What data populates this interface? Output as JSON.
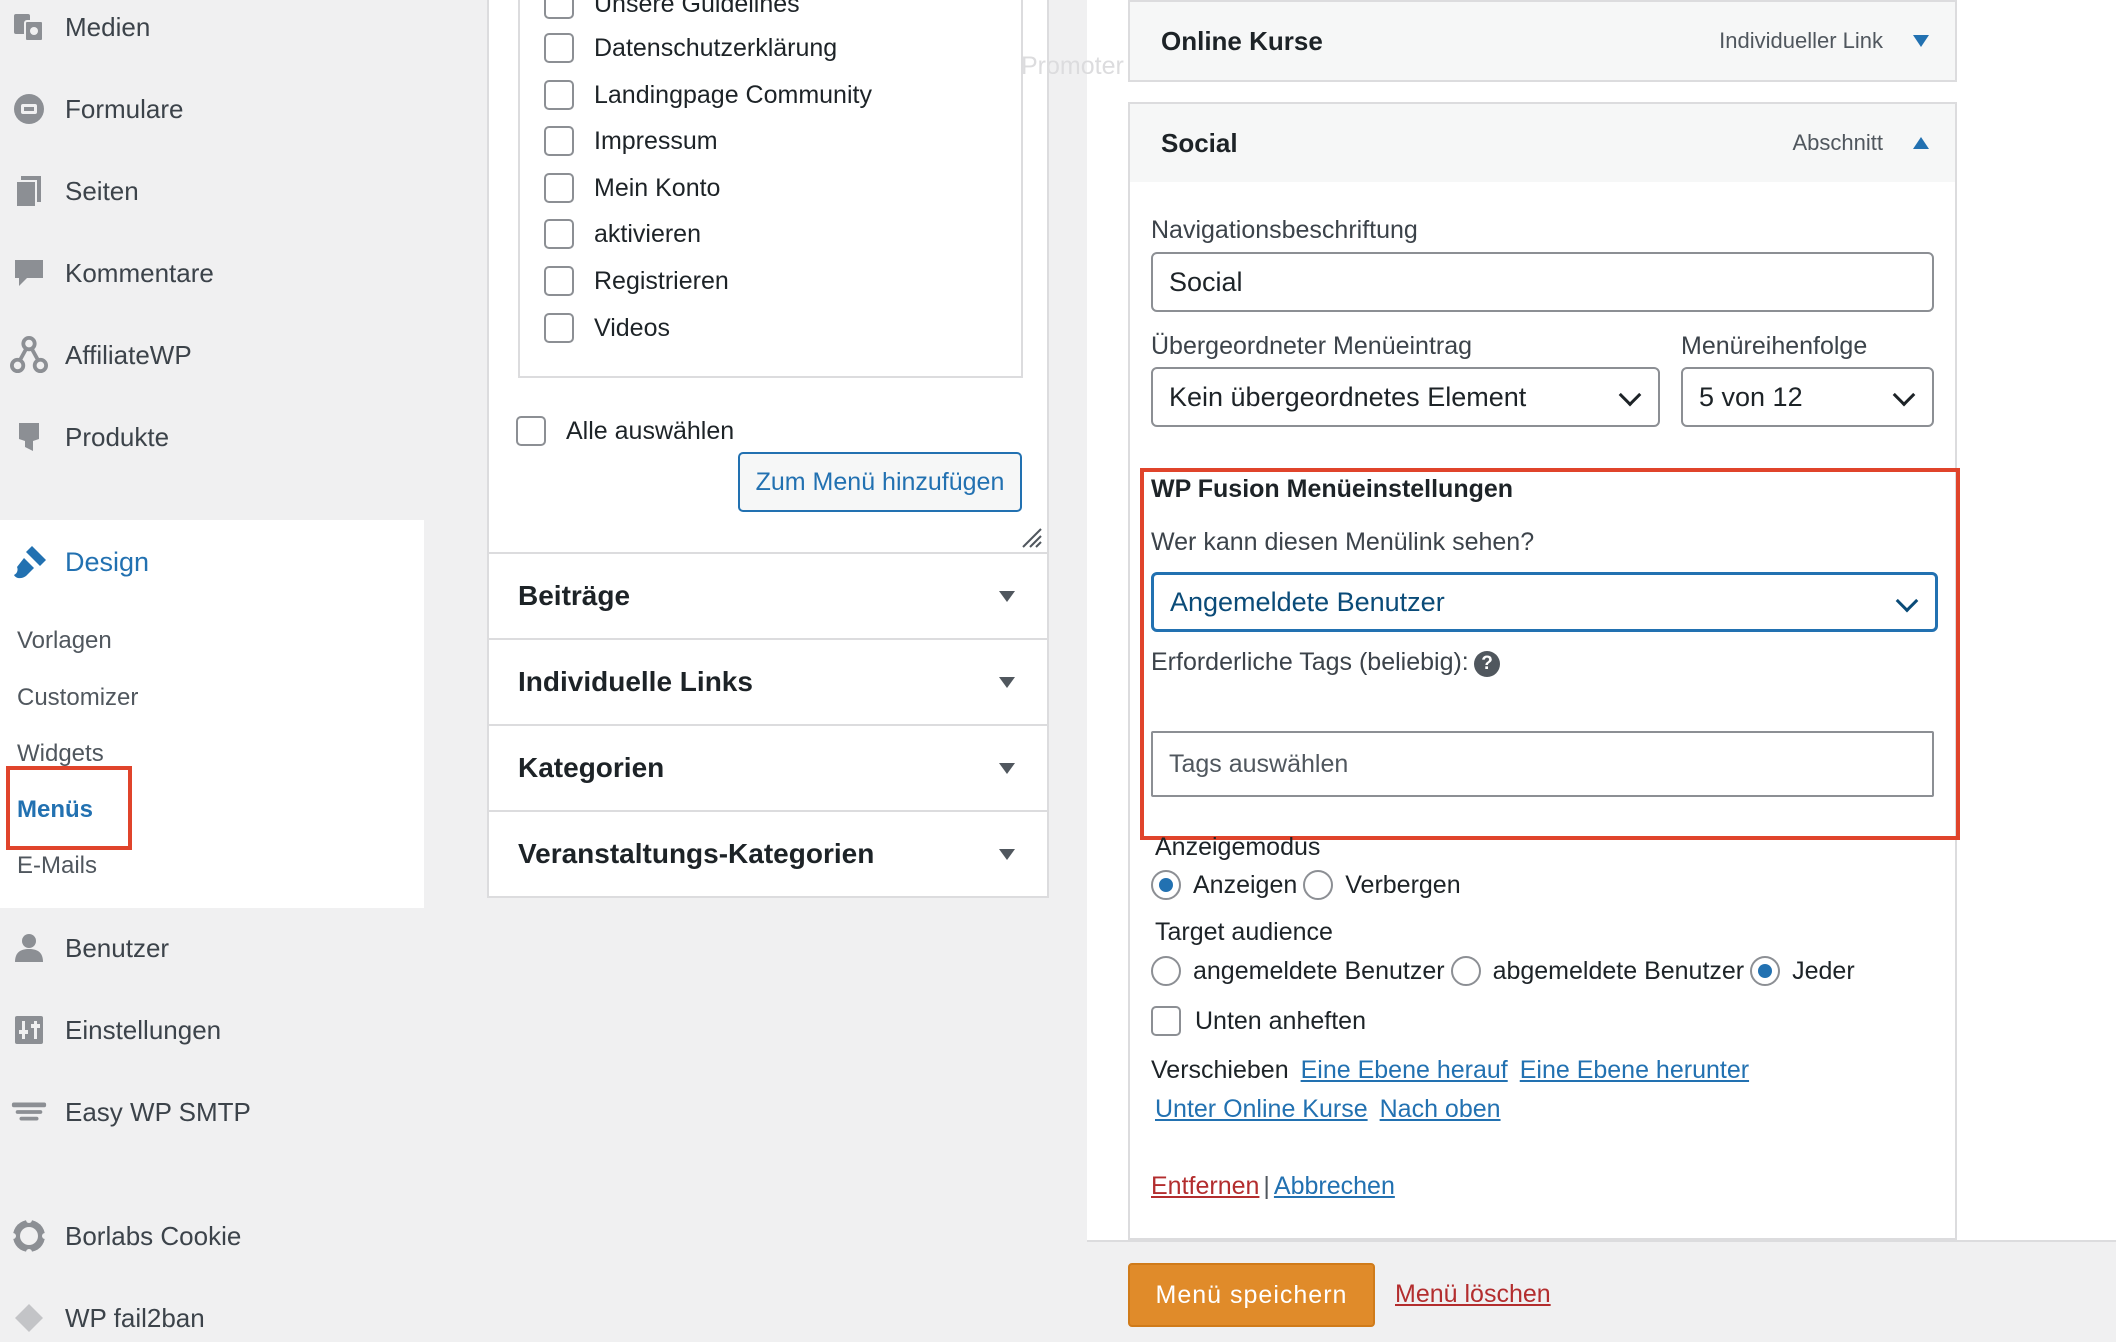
{
  "sidebar": {
    "items": [
      {
        "label": "Medien",
        "icon": "media-icon"
      },
      {
        "label": "Formulare",
        "icon": "forms-icon"
      },
      {
        "label": "Seiten",
        "icon": "pages-icon"
      },
      {
        "label": "Kommentare",
        "icon": "comments-icon"
      },
      {
        "label": "AffiliateWP",
        "icon": "affiliate-icon"
      },
      {
        "label": "Produkte",
        "icon": "products-icon"
      }
    ],
    "design": {
      "label": "Design",
      "sub_items": [
        "Vorlagen",
        "Customizer",
        "Widgets",
        "Menüs",
        "E-Mails"
      ]
    },
    "lower_items": [
      {
        "label": "Benutzer",
        "icon": "users-icon"
      },
      {
        "label": "Einstellungen",
        "icon": "settings-icon"
      },
      {
        "label": "Easy WP SMTP",
        "icon": "smtp-icon"
      },
      {
        "label": "Borlabs Cookie",
        "icon": "cookie-icon"
      },
      {
        "label": "WP fail2ban",
        "icon": "fail2ban-icon"
      }
    ]
  },
  "pages_box": {
    "items": [
      "Unsere Guidelines",
      "Datenschutzerklärung",
      "Landingpage Community",
      "Impressum",
      "Mein Konto",
      "aktivieren",
      "Registrieren",
      "Videos"
    ],
    "select_all_label": "Alle auswählen",
    "add_button": "Zum Menü hinzufügen"
  },
  "accordion": [
    "Beiträge",
    "Individuelle Links",
    "Kategorien",
    "Veranstaltungs-Kategorien"
  ],
  "ghost_text": "Promoter",
  "menu_items": {
    "online_kurse": {
      "title": "Online Kurse",
      "type": "Individueller Link"
    },
    "social": {
      "title": "Social",
      "type": "Abschnitt"
    }
  },
  "settings": {
    "nav_label": "Navigationsbeschriftung",
    "nav_value": "Social",
    "parent_label": "Übergeordneter Menüeintrag",
    "parent_value": "Kein übergeordnetes Element",
    "order_label": "Menüreihenfolge",
    "order_value": "5 von 12",
    "wpf_heading": "WP Fusion Menüeinstellungen",
    "wpf_question": "Wer kann diesen Menülink sehen?",
    "wpf_value": "Angemeldete Benutzer",
    "tags_label": "Erforderliche Tags (beliebig):",
    "tags_help": "?",
    "tags_placeholder": "Tags auswählen",
    "display_mode_label": "Anzeigemodus",
    "display_show": "Anzeigen",
    "display_hide": "Verbergen",
    "audience_label": "Target audience",
    "audience_logged_in": "angemeldete Benutzer",
    "audience_logged_out": "abgemeldete Benutzer",
    "audience_all": "Jeder",
    "pin_bottom": "Unten anheften",
    "move_label": "Verschieben",
    "move_up": "Eine Ebene herauf",
    "move_down": "Eine Ebene herunter",
    "move_under": "Unter Online Kurse",
    "move_top": "Nach oben",
    "remove": "Entfernen",
    "separator": "|",
    "cancel": "Abbrechen"
  },
  "footer": {
    "save": "Menü speichern",
    "delete": "Menü löschen"
  },
  "colors": {
    "accent": "#2271b1",
    "highlight": "#e0442b",
    "save_button": "#e08b2a",
    "danger": "#b32d2e"
  }
}
